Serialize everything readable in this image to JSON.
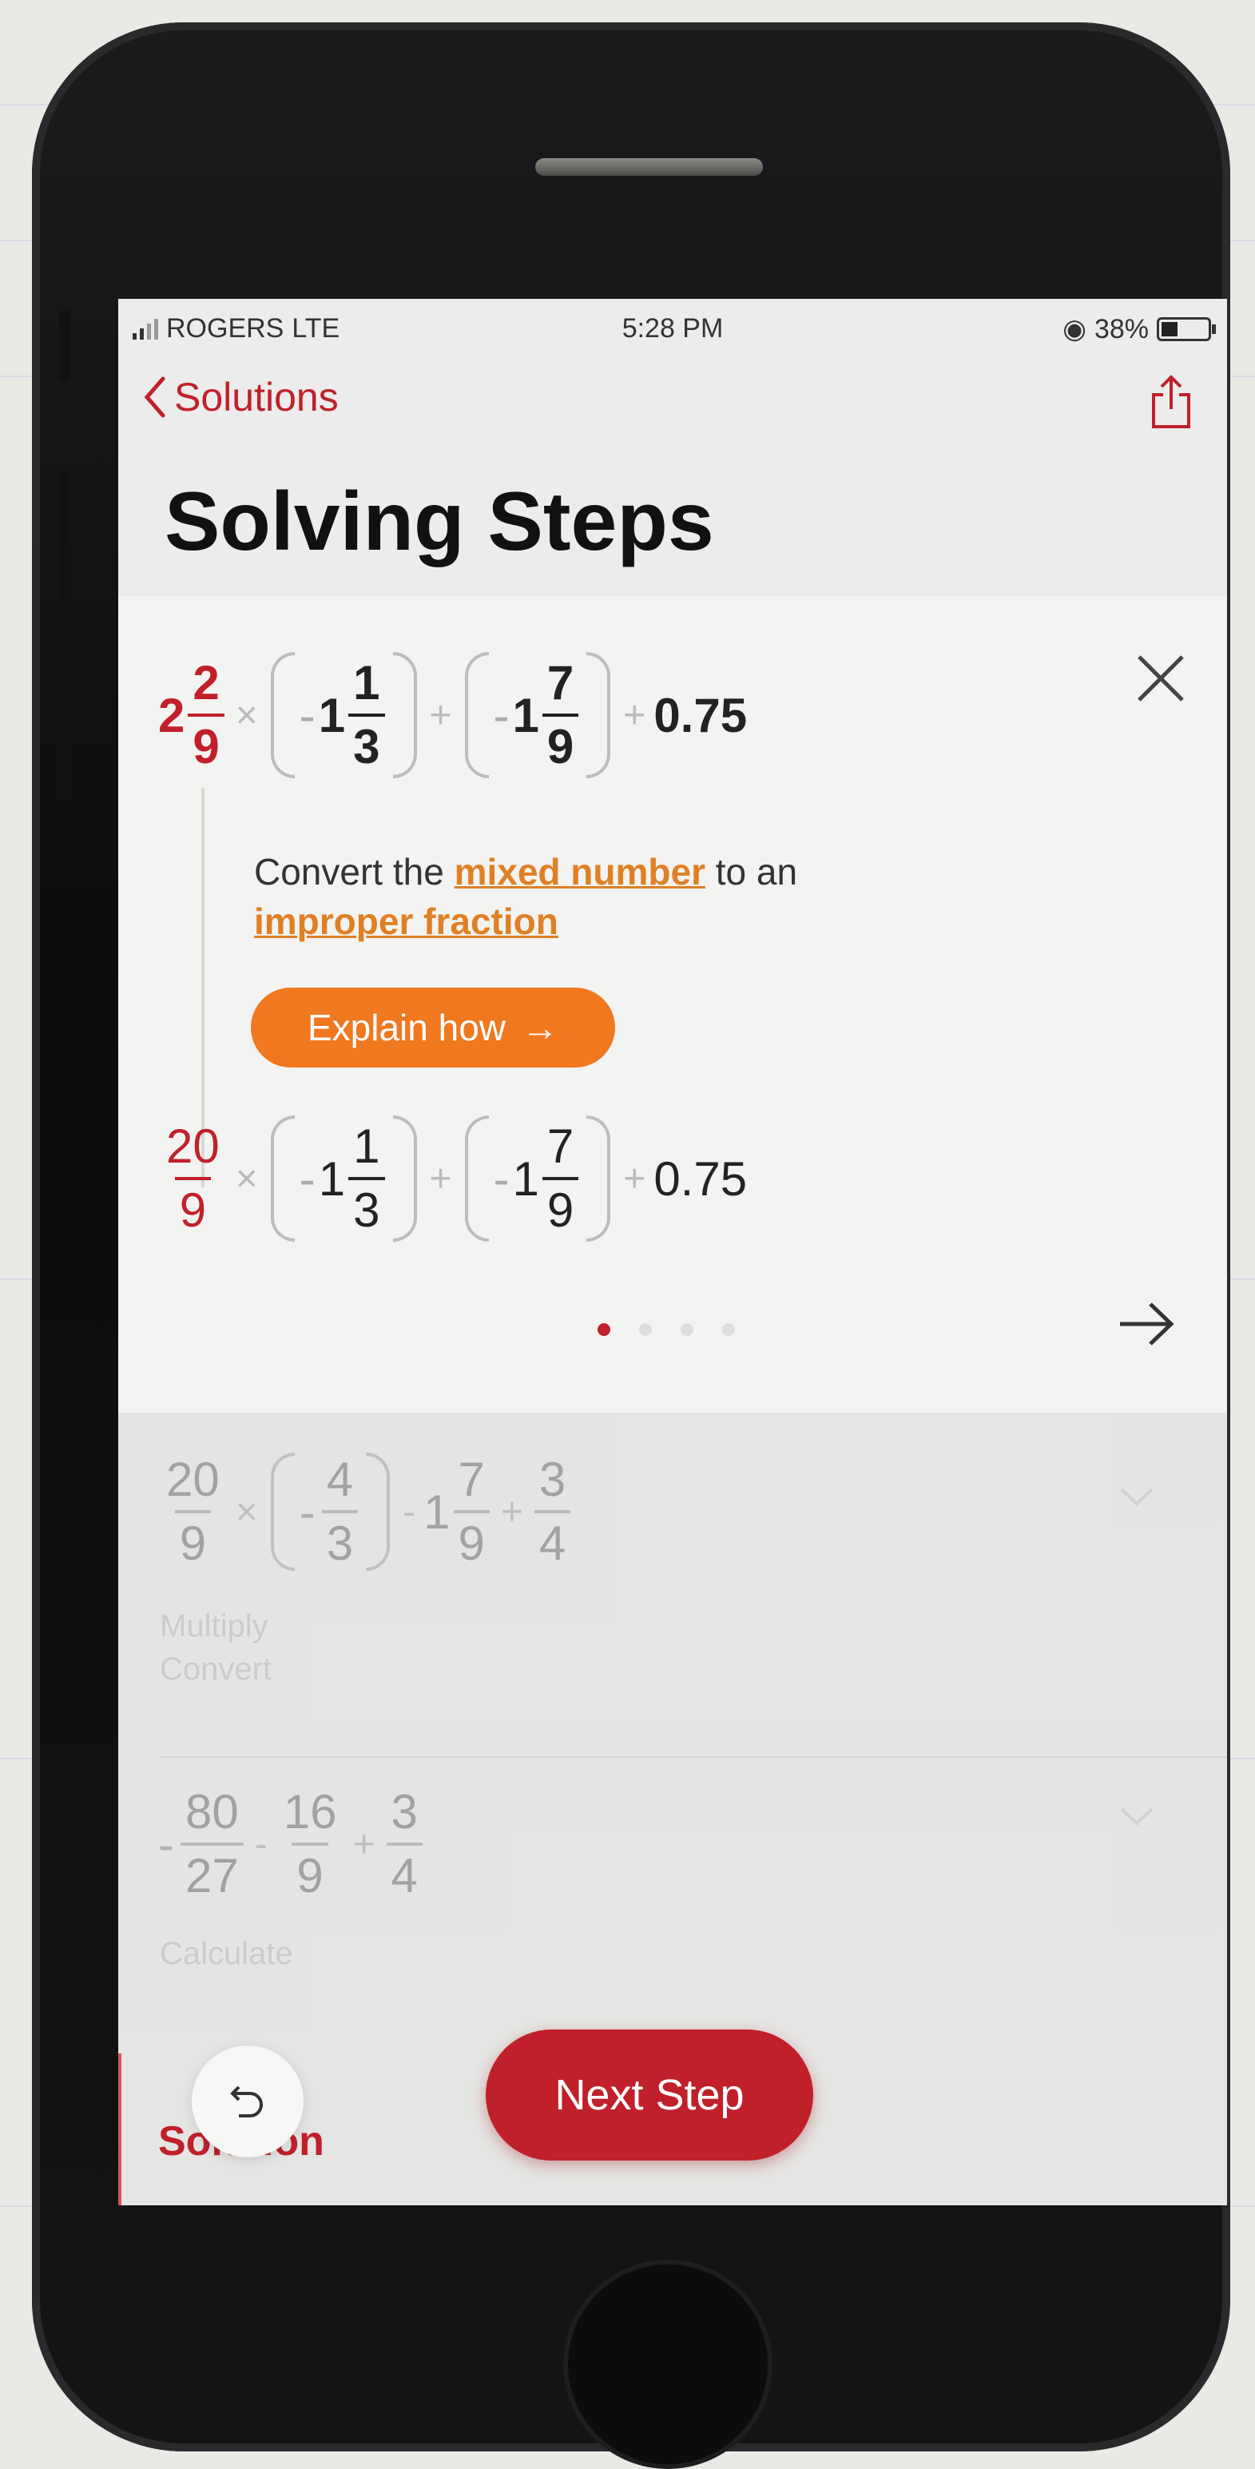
{
  "status_bar": {
    "carrier": "ROGERS",
    "network": "LTE",
    "time": "5:28 PM",
    "battery_percent": "38%"
  },
  "nav": {
    "back_label": "Solutions",
    "title": "Solving Steps"
  },
  "current_step": {
    "expression": {
      "whole": "2",
      "frac1_num": "2",
      "frac1_den": "9",
      "times": "×",
      "neg1": "-",
      "mixed2_whole": "1",
      "mixed2_num": "1",
      "mixed2_den": "3",
      "plus1": "+",
      "neg2": "-",
      "mixed3_whole": "1",
      "mixed3_num": "7",
      "mixed3_den": "9",
      "plus2": "+",
      "decimal": "0.75"
    },
    "instruction_prefix": "Convert the ",
    "instruction_link1": "mixed number",
    "instruction_middle": " to an ",
    "instruction_link2": "improper fraction",
    "explain_button": "Explain how",
    "explain_arrow": "→",
    "result": {
      "frac_num": "20",
      "frac_den": "9",
      "times": "×",
      "neg1": "-",
      "mixed2_whole": "1",
      "mixed2_num": "1",
      "mixed2_den": "3",
      "plus1": "+",
      "neg2": "-",
      "mixed3_whole": "1",
      "mixed3_num": "7",
      "mixed3_den": "9",
      "plus2": "+",
      "decimal": "0.75"
    },
    "pagination": {
      "total": 4,
      "active": 1
    }
  },
  "upcoming_steps": [
    {
      "num1": "20",
      "den1": "9",
      "times": "×",
      "neg": "-",
      "num2": "4",
      "den2": "3",
      "minus": "-",
      "whole3": "1",
      "num3": "7",
      "den3": "9",
      "plus": "+",
      "num4": "3",
      "den4": "4",
      "desc_line1": "Multiply",
      "desc_line2": "Convert"
    },
    {
      "neg": "-",
      "num1": "80",
      "den1": "27",
      "minus": "-",
      "num2": "16",
      "den2": "9",
      "plus": "+",
      "num3": "3",
      "den3": "4",
      "desc_line1": "Calculate"
    }
  ],
  "footer": {
    "solution_label": "Solution",
    "next_step_button": "Next Step"
  },
  "colors": {
    "accent_red": "#c0202a",
    "accent_orange": "#f0781f"
  }
}
